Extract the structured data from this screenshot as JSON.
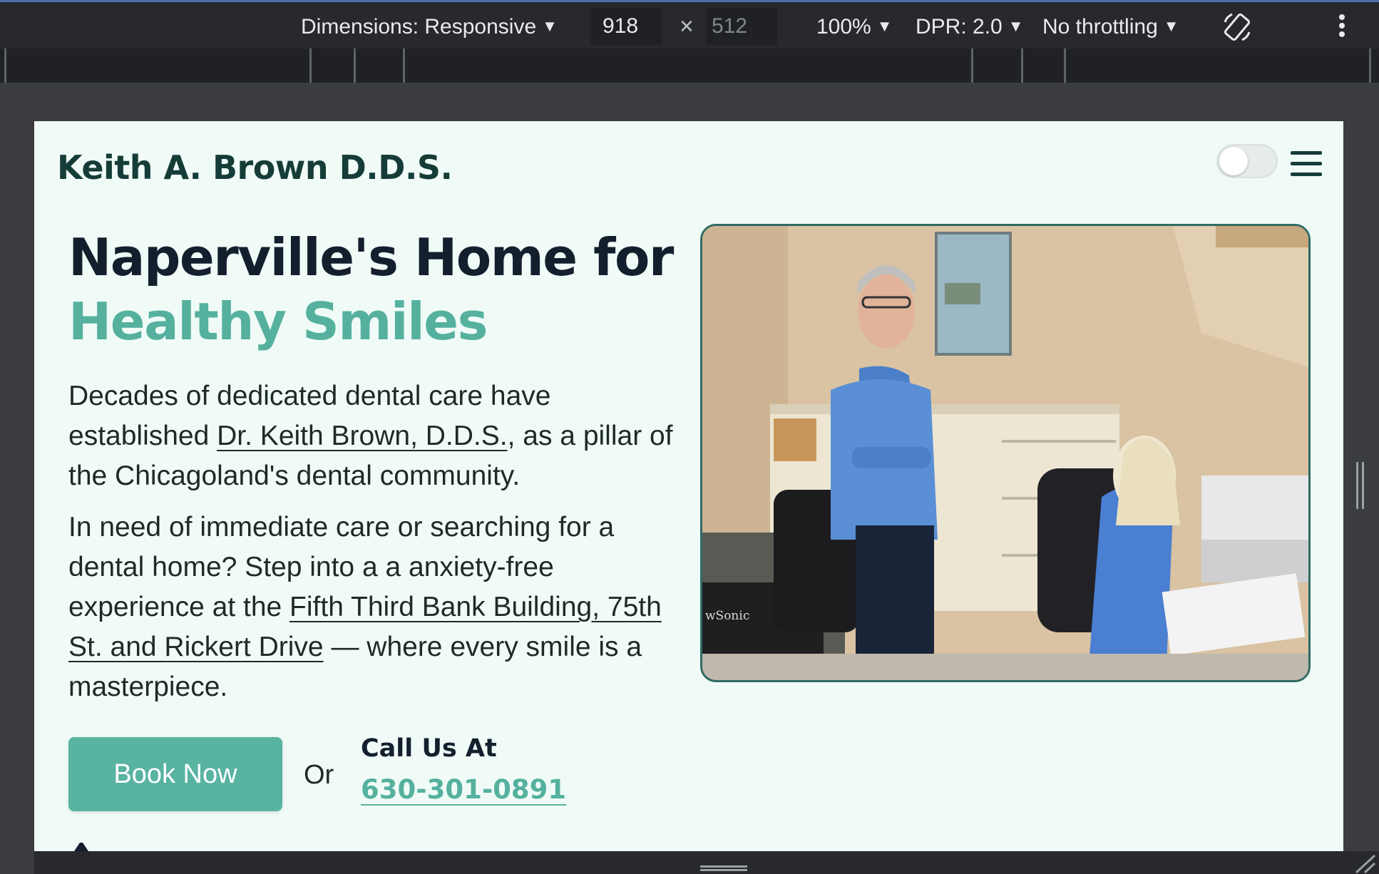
{
  "devtools": {
    "dimensions_label": "Dimensions: Responsive",
    "width": "918",
    "times": "×",
    "height": "512",
    "zoom": "100%",
    "dpr": "DPR: 2.0",
    "throttling": "No throttling",
    "caret": "▼"
  },
  "site": {
    "brand": "Keith A. Brown D.D.S.",
    "headline_line1": "Naperville's Home for",
    "headline_line2": "Healthy Smiles",
    "p1_before": "Decades of dedicated dental care have established ",
    "p1_link": "Dr. Keith Brown, D.D.S.",
    "p1_after": ", as a pillar of the Chicagoland's dental community.",
    "p2_before": "In need of immediate care or searching for a dental home? Step into a a anxiety-free experience at the ",
    "p2_link": "Fifth Third Bank Building, 75th St. and Rickert Drive",
    "p2_after": " — where every smile is a masterpiece.",
    "book_label": "Book Now",
    "or_label": "Or",
    "call_label": "Call Us At",
    "phone": "630-301-0891",
    "photo_monitor_text": "wSonic"
  },
  "colors": {
    "accent": "#55b19e",
    "brand_dark": "#163c38",
    "page_bg": "#f0fbf7",
    "photo_border": "#2f6b63"
  }
}
